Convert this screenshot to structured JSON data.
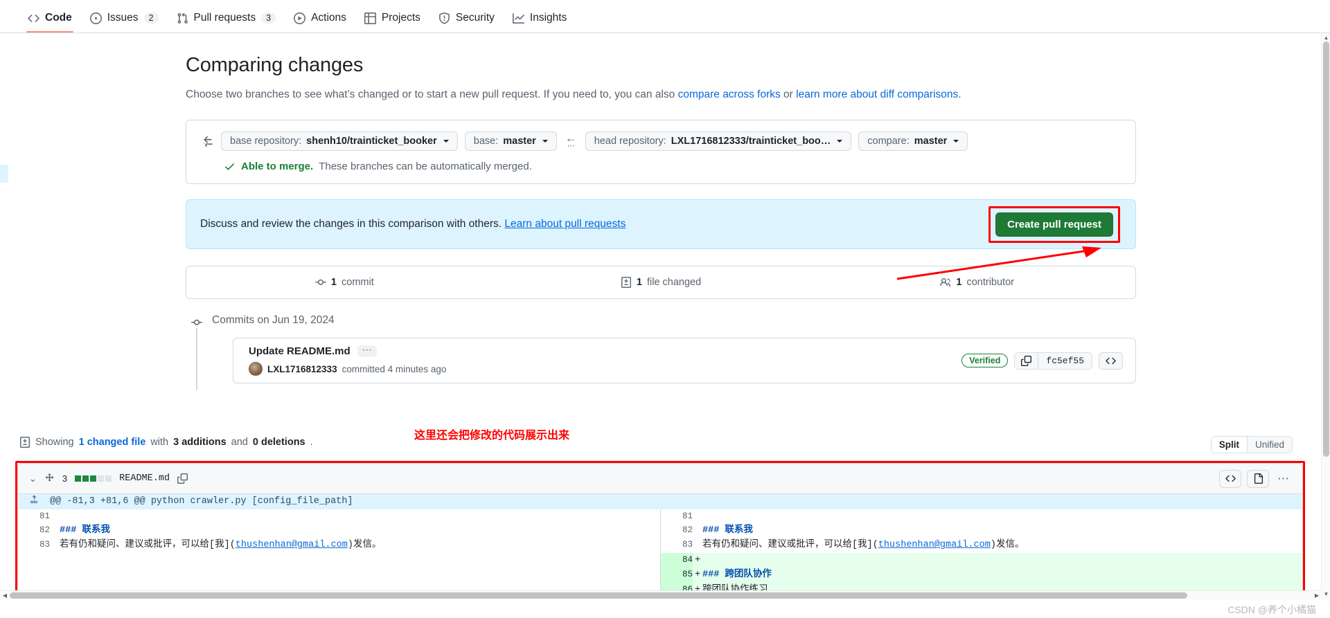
{
  "repo_nav": {
    "items": [
      {
        "label": "Code",
        "icon": "code-icon",
        "count": null,
        "selected": true
      },
      {
        "label": "Issues",
        "icon": "issue-opened-icon",
        "count": "2",
        "selected": false
      },
      {
        "label": "Pull requests",
        "icon": "git-pull-request-icon",
        "count": "3",
        "selected": false
      },
      {
        "label": "Actions",
        "icon": "play-icon",
        "count": null,
        "selected": false
      },
      {
        "label": "Projects",
        "icon": "table-icon",
        "count": null,
        "selected": false
      },
      {
        "label": "Security",
        "icon": "shield-icon",
        "count": null,
        "selected": false
      },
      {
        "label": "Insights",
        "icon": "graph-icon",
        "count": null,
        "selected": false
      }
    ]
  },
  "header": {
    "title": "Comparing changes",
    "subtitle_part1": "Choose two branches to see what’s changed or to start a new pull request. If you need to, you can also ",
    "subtitle_link1": "compare across forks",
    "subtitle_mid": " or ",
    "subtitle_link2": "learn more about diff comparisons",
    "subtitle_end": "."
  },
  "compare": {
    "swap_icon": "arrow-switch-icon",
    "base_repo": {
      "label": "base repository:",
      "value": "shenh10/trainticket_booker"
    },
    "base_branch": {
      "label": "base:",
      "value": "master"
    },
    "direction_arrow": "←",
    "direction_dots": "⋯",
    "head_repo": {
      "label": "head repository:",
      "value": "LXL1716812333/trainticket_boo…"
    },
    "compare_branch": {
      "label": "compare:",
      "value": "master"
    },
    "merge_status_strong": "Able to merge.",
    "merge_status_text": " These branches can be automatically merged.",
    "merge_icon": "check-icon"
  },
  "callout": {
    "text": "Discuss and review the changes in this comparison with others.",
    "link": "Learn about pull requests",
    "button": "Create pull request",
    "button_color": "#1f7a36",
    "highlight_color": "#ff0000",
    "background_color": "#ddf4ff"
  },
  "stats": [
    {
      "icon": "commit-icon",
      "count": "1",
      "label": "commit"
    },
    {
      "icon": "file-diff-icon",
      "count": "1",
      "label": "file changed"
    },
    {
      "icon": "people-icon",
      "count": "1",
      "label": "contributor"
    }
  ],
  "commits": {
    "date_heading": "Commits on Jun 19, 2024",
    "items": [
      {
        "title": "Update README.md",
        "ellipsis": "⋯",
        "author": "LXL1716812333",
        "meta": "committed 4 minutes ago",
        "verified": "Verified",
        "sha": "fc5ef55",
        "copy_icon": "copy-icon",
        "code_icon": "code-icon"
      }
    ]
  },
  "annotation": {
    "text": "这里还会把修改的代码展示出来",
    "color": "#ff0000"
  },
  "showing": {
    "icon": "file-diff-icon",
    "prefix": "Showing ",
    "link": "1 changed file",
    "mid": " with ",
    "additions": "3 additions",
    "and": " and ",
    "deletions": "0 deletions",
    "end": "."
  },
  "view_toggle": {
    "split": "Split",
    "unified": "Unified",
    "selected": "Split"
  },
  "diff": {
    "chevron": "⌄",
    "move_icon": "move-icon",
    "change_count": "3",
    "blocks": [
      "g",
      "g",
      "g",
      "e",
      "e"
    ],
    "filename": "README.md",
    "copy_icon": "copy-icon",
    "actions": [
      {
        "icon": "code-icon",
        "name": "view-file-code"
      },
      {
        "icon": "file-icon",
        "name": "view-file"
      }
    ],
    "kebab": "⋯",
    "hunk_header": "@@ -81,3 +81,6 @@ python crawler.py [config_file_path]",
    "expand_icon": "unfold-icon",
    "left_rows": [
      {
        "num": "81",
        "sign": "",
        "type": "context",
        "segments": []
      },
      {
        "num": "82",
        "sign": "",
        "type": "context",
        "segments": [
          {
            "text": "### 联系我",
            "style": "heading"
          }
        ]
      },
      {
        "num": "83",
        "sign": "",
        "type": "context",
        "segments": [
          {
            "text": "若有仍和疑问、建议或批评，可以给[我](",
            "style": "plain"
          },
          {
            "text": "thushenhan@gmail.com",
            "style": "link"
          },
          {
            "text": ")发信。",
            "style": "plain"
          }
        ]
      },
      {
        "num": "",
        "sign": "",
        "type": "blank",
        "segments": []
      },
      {
        "num": "",
        "sign": "",
        "type": "blank",
        "segments": []
      },
      {
        "num": "",
        "sign": "",
        "type": "blank",
        "segments": []
      }
    ],
    "right_rows": [
      {
        "num": "81",
        "sign": "",
        "type": "context",
        "segments": []
      },
      {
        "num": "82",
        "sign": "",
        "type": "context",
        "segments": [
          {
            "text": "### 联系我",
            "style": "heading"
          }
        ]
      },
      {
        "num": "83",
        "sign": "",
        "type": "context",
        "segments": [
          {
            "text": "若有仍和疑问、建议或批评，可以给[我](",
            "style": "plain"
          },
          {
            "text": "thushenhan@gmail.com",
            "style": "link"
          },
          {
            "text": ")发信。",
            "style": "plain"
          }
        ]
      },
      {
        "num": "84",
        "sign": "+",
        "type": "add",
        "segments": []
      },
      {
        "num": "85",
        "sign": "+",
        "type": "add",
        "segments": [
          {
            "text": "### 跨团队协作",
            "style": "heading"
          }
        ]
      },
      {
        "num": "86",
        "sign": "+",
        "type": "add",
        "segments": [
          {
            "text": "跨团队协作练习",
            "style": "plain"
          }
        ]
      }
    ]
  },
  "watermark": "CSDN @养个小橘猫"
}
